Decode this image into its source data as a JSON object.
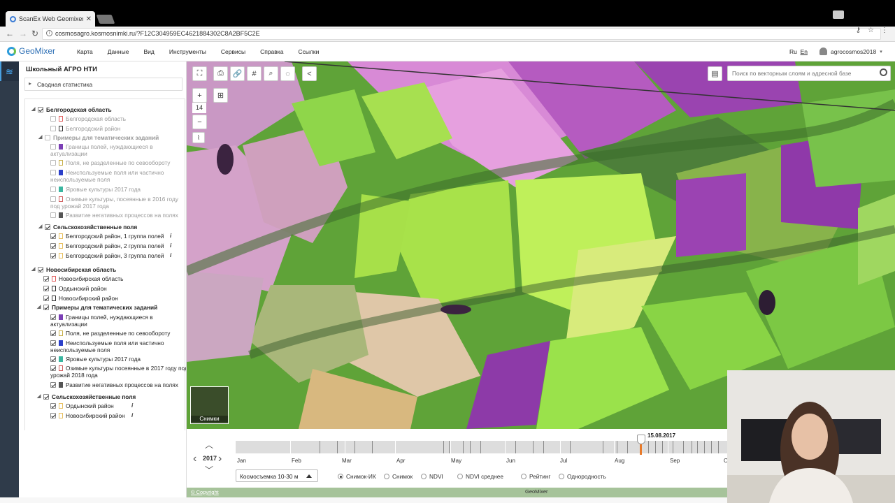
{
  "browser": {
    "tab_title": "ScanEx Web Geomixer - п",
    "url": "cosmosagro.kosmosnimki.ru/?F12C304959EC4621884302C8A2BF5C2E"
  },
  "app": {
    "logo": "GeoMixer",
    "menu": [
      "Карта",
      "Данные",
      "Вид",
      "Инструменты",
      "Сервисы",
      "Справка",
      "Ссылки"
    ],
    "lang_ru": "Ru",
    "lang_en": "En",
    "user": "agrocosmos2018"
  },
  "panel": {
    "title": "Школьный АГРО НТИ",
    "stats": "Сводная статистика",
    "rows": [
      {
        "label": "Белгородская область",
        "cls": "b",
        "cb": "on",
        "sw": ""
      },
      {
        "label": "Белгородская область",
        "cls": "g",
        "cb": "dim",
        "sw": "#e06060"
      },
      {
        "label": "Белгородский район",
        "cls": "g",
        "cb": "dim",
        "sw": "#333"
      },
      {
        "label": "Примеры для тематических заданий",
        "cls": "g b",
        "cb": "dim",
        "sw": ""
      },
      {
        "label": "Границы полей, нуждающиеся в",
        "label2": "актуализации",
        "cls": "g",
        "cb": "dim",
        "sw": "#7b3fb5"
      },
      {
        "label": "Поля, не разделенные по севообороту",
        "cls": "g",
        "cb": "dim",
        "sw": "#c8b04a"
      },
      {
        "label": "Неиспользуемые поля или частично",
        "label2": "неиспользуемые поля",
        "cls": "g",
        "cb": "dim",
        "sw": "#2b3fc9"
      },
      {
        "label": "Яровые культуры 2017 года",
        "cls": "g",
        "cb": "dim",
        "sw": "#3bb6a0"
      },
      {
        "label": "Озимые культуры, посеянные в 2016 году",
        "label2": "под урожай 2017 года",
        "cls": "g",
        "cb": "dim",
        "sw": "#d06060"
      },
      {
        "label": "Развитие негативных процессов на полях",
        "cls": "g",
        "cb": "dim",
        "sw": "#555"
      },
      {
        "label": "Сельскохозяйственные поля",
        "cls": "b",
        "cb": "on",
        "sw": ""
      },
      {
        "label": "Белгородский район, 1 группа полей",
        "cls": "",
        "cb": "on",
        "sw": "#e8c060"
      },
      {
        "label": "Белгородский район, 2 группа полей",
        "cls": "",
        "cb": "on",
        "sw": "#e8c060"
      },
      {
        "label": "Белгородский район, 3 группа полей",
        "cls": "",
        "cb": "on",
        "sw": "#e8c060"
      },
      {
        "label": "Новосибирская область",
        "cls": "b",
        "cb": "on",
        "sw": ""
      },
      {
        "label": "Новосибирская область",
        "cls": "",
        "cb": "on",
        "sw": "#e06060"
      },
      {
        "label": "Ордынский район",
        "cls": "",
        "cb": "on",
        "sw": "#333"
      },
      {
        "label": "Новосибирский район",
        "cls": "",
        "cb": "on",
        "sw": "#333"
      },
      {
        "label": "Примеры для тематических заданий",
        "cls": "b",
        "cb": "on",
        "sw": ""
      },
      {
        "label": "Границы полей, нуждающиеся в",
        "label2": "актуализации",
        "cls": "",
        "cb": "on",
        "sw": "#7b3fb5"
      },
      {
        "label": "Поля, не разделенные по севообороту",
        "cls": "",
        "cb": "on",
        "sw": "#c8b04a"
      },
      {
        "label": "Неиспользуемые поля или частично",
        "label2": "неиспользуемые поля",
        "cls": "",
        "cb": "on",
        "sw": "#2b3fc9"
      },
      {
        "label": "Яровые культуры 2017 года",
        "cls": "",
        "cb": "on",
        "sw": "#3bb6a0"
      },
      {
        "label": "Озимые культуры посеянные в 2017 году под",
        "label2": "урожай 2018 года",
        "cls": "",
        "cb": "on",
        "sw": "#d06060"
      },
      {
        "label": "Развитие негативных процессов на полях",
        "cls": "",
        "cb": "on",
        "sw": "#555"
      },
      {
        "label": "Сельскохозяйственные поля",
        "cls": "b",
        "cb": "on",
        "sw": ""
      },
      {
        "label": "Ордынский район",
        "cls": "",
        "cb": "on",
        "sw": "#e8c060"
      },
      {
        "label": "Новосибирский район",
        "cls": "",
        "cb": "on",
        "sw": "#e8c060"
      }
    ]
  },
  "map": {
    "zoom": "14",
    "search_placeholder": "Поиск по векторным слоям и адресной базе",
    "thumb_label": "Снимки"
  },
  "timeline": {
    "year": "2017",
    "months": [
      "Jan",
      "Feb",
      "Mar",
      "Apr",
      "May",
      "Jun",
      "Jul",
      "Aug",
      "Sep",
      "O"
    ],
    "selected_date": "15.08.2017",
    "dropdown": "Космосъемка 10-30 м",
    "modes": [
      "Снимок-ИК",
      "Снимок",
      "NDVI",
      "NDVI среднее",
      "Рейтинг",
      "Однородность"
    ],
    "selected_mode": "Снимок-ИК"
  },
  "footer": {
    "copyright": "© Copyright",
    "brand": "GeoMixer"
  }
}
